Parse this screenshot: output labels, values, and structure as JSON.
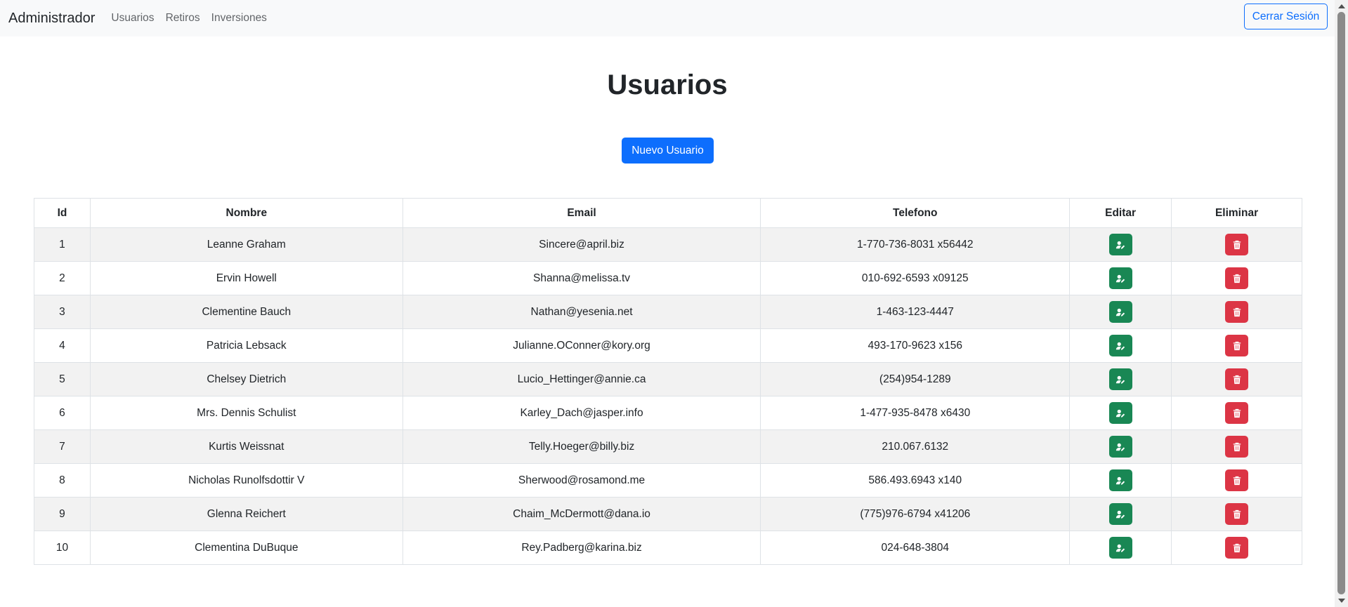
{
  "navbar": {
    "brand": "Administrador",
    "links": [
      "Usuarios",
      "Retiros",
      "Inversiones"
    ],
    "logout_label": "Cerrar Sesión"
  },
  "main": {
    "title": "Usuarios",
    "new_user_label": "Nuevo Usuario"
  },
  "table": {
    "headers": [
      "Id",
      "Nombre",
      "Email",
      "Telefono",
      "Editar",
      "Eliminar"
    ],
    "rows": [
      {
        "id": "1",
        "name": "Leanne Graham",
        "email": "Sincere@april.biz",
        "phone": "1-770-736-8031 x56442"
      },
      {
        "id": "2",
        "name": "Ervin Howell",
        "email": "Shanna@melissa.tv",
        "phone": "010-692-6593 x09125"
      },
      {
        "id": "3",
        "name": "Clementine Bauch",
        "email": "Nathan@yesenia.net",
        "phone": "1-463-123-4447"
      },
      {
        "id": "4",
        "name": "Patricia Lebsack",
        "email": "Julianne.OConner@kory.org",
        "phone": "493-170-9623 x156"
      },
      {
        "id": "5",
        "name": "Chelsey Dietrich",
        "email": "Lucio_Hettinger@annie.ca",
        "phone": "(254)954-1289"
      },
      {
        "id": "6",
        "name": "Mrs. Dennis Schulist",
        "email": "Karley_Dach@jasper.info",
        "phone": "1-477-935-8478 x6430"
      },
      {
        "id": "7",
        "name": "Kurtis Weissnat",
        "email": "Telly.Hoeger@billy.biz",
        "phone": "210.067.6132"
      },
      {
        "id": "8",
        "name": "Nicholas Runolfsdottir V",
        "email": "Sherwood@rosamond.me",
        "phone": "586.493.6943 x140"
      },
      {
        "id": "9",
        "name": "Glenna Reichert",
        "email": "Chaim_McDermott@dana.io",
        "phone": "(775)976-6794 x41206"
      },
      {
        "id": "10",
        "name": "Clementina DuBuque",
        "email": "Rey.Padberg@karina.biz",
        "phone": "024-648-3804"
      }
    ]
  },
  "icons": {
    "edit": "user-edit-icon",
    "delete": "trash-icon"
  },
  "colors": {
    "primary": "#0d6efd",
    "success": "#198754",
    "danger": "#dc3545",
    "navbar_bg": "#f8f9fa",
    "stripe": "#f2f2f2"
  }
}
